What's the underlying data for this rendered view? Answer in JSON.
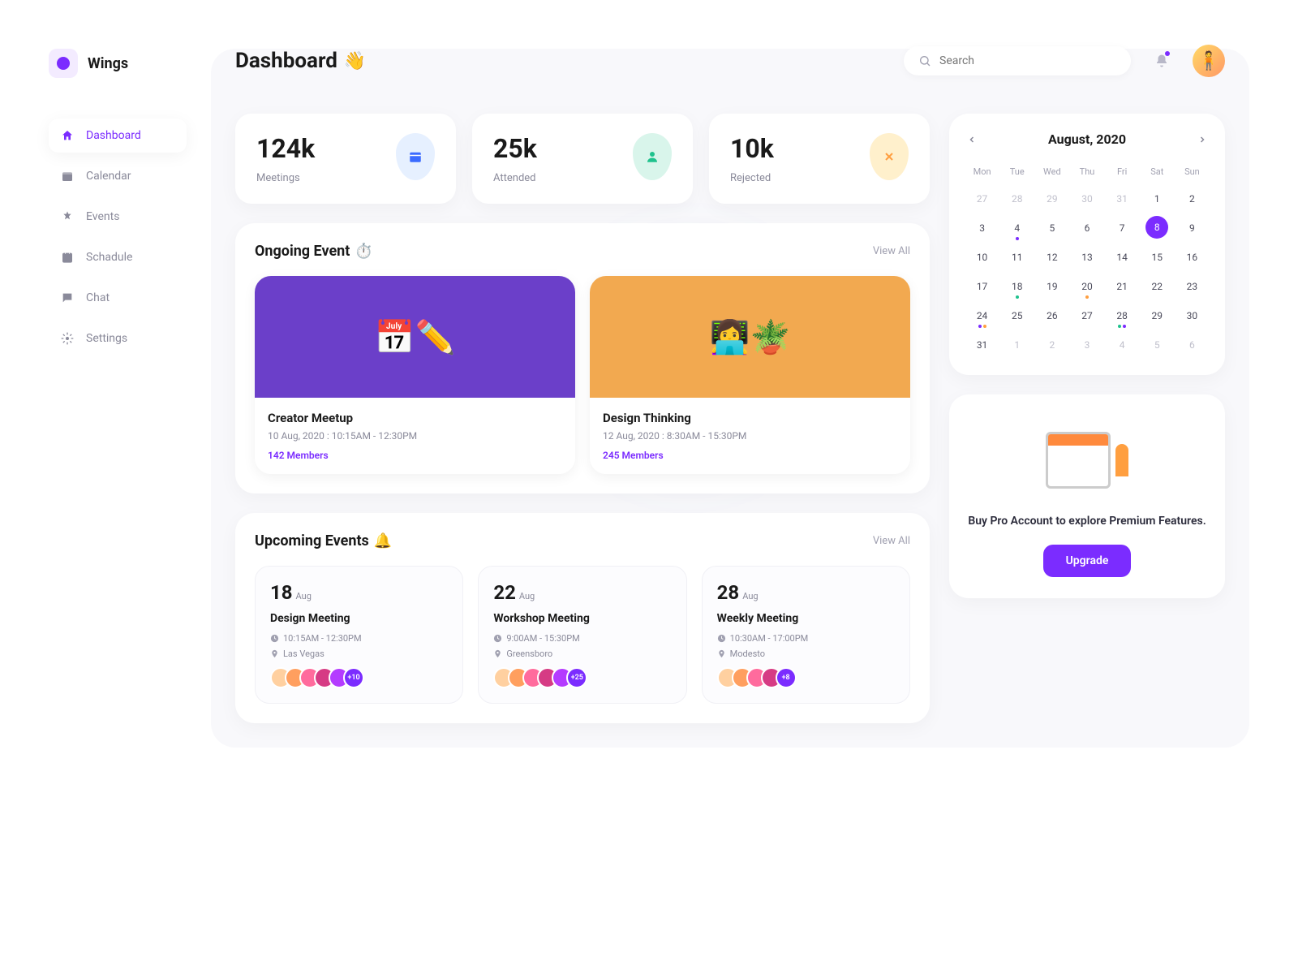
{
  "brand": {
    "name": "Wings"
  },
  "page": {
    "title": "Dashboard",
    "emoji": "👋"
  },
  "search": {
    "placeholder": "Search"
  },
  "nav": [
    {
      "label": "Dashboard",
      "active": true
    },
    {
      "label": "Calendar",
      "active": false
    },
    {
      "label": "Events",
      "active": false
    },
    {
      "label": "Schadule",
      "active": false
    },
    {
      "label": "Chat",
      "active": false
    },
    {
      "label": "Settings",
      "active": false
    }
  ],
  "stats": [
    {
      "value": "124k",
      "label": "Meetings",
      "icon": "calendar-icon",
      "color": "blue"
    },
    {
      "value": "25k",
      "label": "Attended",
      "icon": "user-icon",
      "color": "teal"
    },
    {
      "value": "10k",
      "label": "Rejected",
      "icon": "x-icon",
      "color": "yellow"
    }
  ],
  "ongoing": {
    "title": "Ongoing Event",
    "emoji": "⏱️",
    "view_all": "View All",
    "events": [
      {
        "title": "Creator Meetup",
        "time": "10 Aug, 2020 :  10:15AM - 12:30PM",
        "members": "142 Members",
        "bg": "purple"
      },
      {
        "title": "Design Thinking",
        "time": "12 Aug, 2020 :  8:30AM - 15:30PM",
        "members": "245 Members",
        "bg": "orange"
      }
    ]
  },
  "upcoming": {
    "title": "Upcoming Events",
    "emoji": "🔔",
    "view_all": "View All",
    "events": [
      {
        "day": "18",
        "month": "Aug",
        "title": "Design Meeting",
        "time": "10:15AM - 12:30PM",
        "location": "Las Vegas",
        "more": "+10",
        "avcount": 5
      },
      {
        "day": "22",
        "month": "Aug",
        "title": "Workshop Meeting",
        "time": "9:00AM - 15:30PM",
        "location": "Greensboro",
        "more": "+25",
        "avcount": 5
      },
      {
        "day": "28",
        "month": "Aug",
        "title": "Weekly Meeting",
        "time": "10:30AM - 17:00PM",
        "location": "Modesto",
        "more": "+8",
        "avcount": 4
      }
    ]
  },
  "calendar": {
    "title": "August, 2020",
    "dow": [
      "Mon",
      "Tue",
      "Wed",
      "Thu",
      "Fri",
      "Sat",
      "Sun"
    ],
    "weeks": [
      [
        {
          "d": "27",
          "m": true
        },
        {
          "d": "28",
          "m": true
        },
        {
          "d": "29",
          "m": true
        },
        {
          "d": "30",
          "m": true
        },
        {
          "d": "31",
          "m": true
        },
        {
          "d": "1"
        },
        {
          "d": "2"
        }
      ],
      [
        {
          "d": "3"
        },
        {
          "d": "4",
          "dots": [
            "#7b2cff"
          ]
        },
        {
          "d": "5"
        },
        {
          "d": "6"
        },
        {
          "d": "7"
        },
        {
          "d": "8",
          "sel": true
        },
        {
          "d": "9"
        }
      ],
      [
        {
          "d": "10"
        },
        {
          "d": "11"
        },
        {
          "d": "12"
        },
        {
          "d": "13"
        },
        {
          "d": "14"
        },
        {
          "d": "15"
        },
        {
          "d": "16"
        }
      ],
      [
        {
          "d": "17"
        },
        {
          "d": "18",
          "dots": [
            "#1fc28d"
          ]
        },
        {
          "d": "19"
        },
        {
          "d": "20",
          "dots": [
            "#ff9f40"
          ]
        },
        {
          "d": "21"
        },
        {
          "d": "22"
        },
        {
          "d": "23"
        }
      ],
      [
        {
          "d": "24",
          "dots": [
            "#7b2cff",
            "#ff9f40"
          ]
        },
        {
          "d": "25"
        },
        {
          "d": "26"
        },
        {
          "d": "27"
        },
        {
          "d": "28",
          "dots": [
            "#1fc28d",
            "#7b2cff"
          ]
        },
        {
          "d": "29"
        },
        {
          "d": "30"
        }
      ],
      [
        {
          "d": "31"
        },
        {
          "d": "1",
          "m": true
        },
        {
          "d": "2",
          "m": true
        },
        {
          "d": "3",
          "m": true
        },
        {
          "d": "4",
          "m": true
        },
        {
          "d": "5",
          "m": true
        },
        {
          "d": "6",
          "m": true
        }
      ]
    ]
  },
  "promo": {
    "text": "Buy Pro Account to explore Premium Features.",
    "button": "Upgrade"
  },
  "avatar_colors": [
    "#ffd0a0",
    "#ff9f5f",
    "#ff6b9d",
    "#d63b84",
    "#b43bff",
    "#4bc4ff"
  ]
}
